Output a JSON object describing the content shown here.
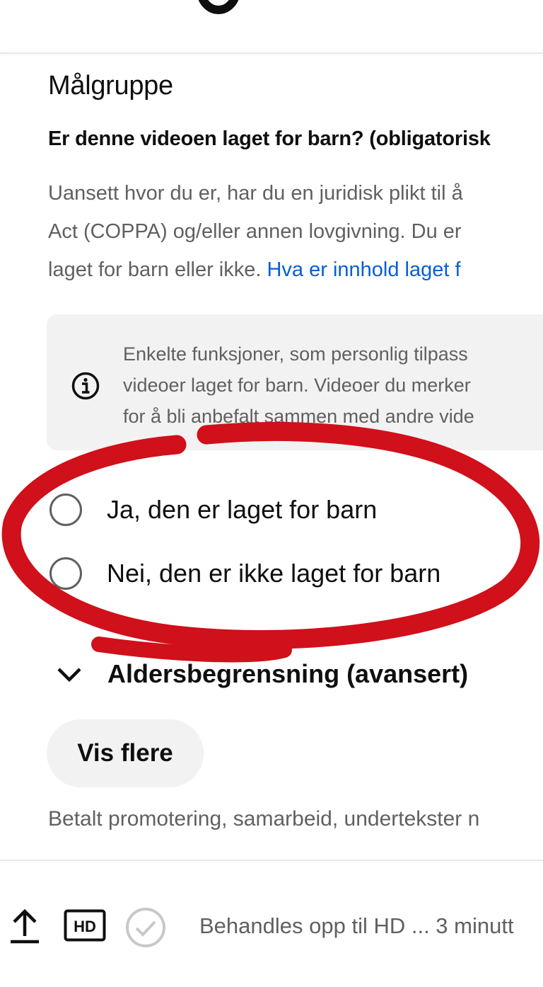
{
  "audience": {
    "title": "Målgruppe",
    "question": "Er denne videoen laget for barn? (obligatorisk",
    "description_lines": [
      "Uansett hvor du er, har du en juridisk plikt til å",
      "Act (COPPA) og/eller annen lovgivning. Du er"
    ],
    "description_last_prefix": "laget for barn eller ikke. ",
    "description_link": "Hva er innhold laget f",
    "info_lines": [
      "Enkelte funksjoner, som personlig tilpass",
      "videoer laget for barn. Videoer du merker",
      "for å bli anbefalt sammen med andre vide"
    ],
    "options": [
      {
        "label": "Ja, den er laget for barn",
        "selected": false
      },
      {
        "label": "Nei, den er ikke laget for barn",
        "selected": false
      }
    ]
  },
  "age_restriction": {
    "label": "Aldersbegrensning (avansert)"
  },
  "show_more": {
    "label": "Vis flere"
  },
  "footer_hint": "Betalt promotering, samarbeid, undertekster n",
  "status": {
    "text": "Behandles opp til HD ... 3 minutt",
    "hd_badge": "HD"
  },
  "icons": {
    "info": "info-icon",
    "chevron": "chevron-down-icon",
    "upload": "upload-icon",
    "hd": "hd-icon",
    "check": "check-circle-icon"
  },
  "colors": {
    "text_primary": "#0f0f0f",
    "text_secondary": "#606060",
    "link": "#065fd4",
    "surface": "#f2f2f2",
    "annotation_red": "#d0101a"
  }
}
